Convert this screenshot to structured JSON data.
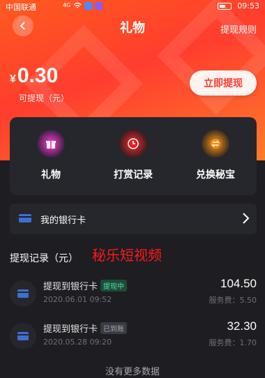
{
  "status_bar": {
    "carrier": "中国联通",
    "network": "4G",
    "battery_percent": 60,
    "time": "09:53"
  },
  "header": {
    "title": "礼物",
    "rules_label": "提现规则"
  },
  "balance": {
    "currency": "¥",
    "amount": "0.30",
    "label": "可提现（元）",
    "withdraw_label": "立即提现"
  },
  "actions": [
    {
      "label": "礼物",
      "icon": "gift-icon",
      "color": "#ff3fd6"
    },
    {
      "label": "打赏记录",
      "icon": "clock-icon",
      "color": "#ff2a2a"
    },
    {
      "label": "兑换秘宝",
      "icon": "exchange-icon",
      "color": "#ff9a1a"
    }
  ],
  "bank_card": {
    "label": "我的银行卡"
  },
  "records": {
    "title": "提现记录（元）",
    "watermark": "秘乐短视频",
    "items": [
      {
        "title": "提现到银行卡",
        "tag": "提现中",
        "date": "2020.06.01 09:52",
        "amount": "104.50",
        "fee": "服务费：5.50"
      },
      {
        "title": "提现到银行卡",
        "tag": "已到账",
        "date": "2020.05.28 09:20",
        "amount": "32.30",
        "fee": "服务费：1.70"
      }
    ],
    "no_more": "没有更多数据"
  },
  "colors": {
    "brand_orange": "#ff5a1f",
    "dark_bg": "#1d1d22",
    "card_bg": "#26262d",
    "accent_red": "#ff3b2f"
  }
}
